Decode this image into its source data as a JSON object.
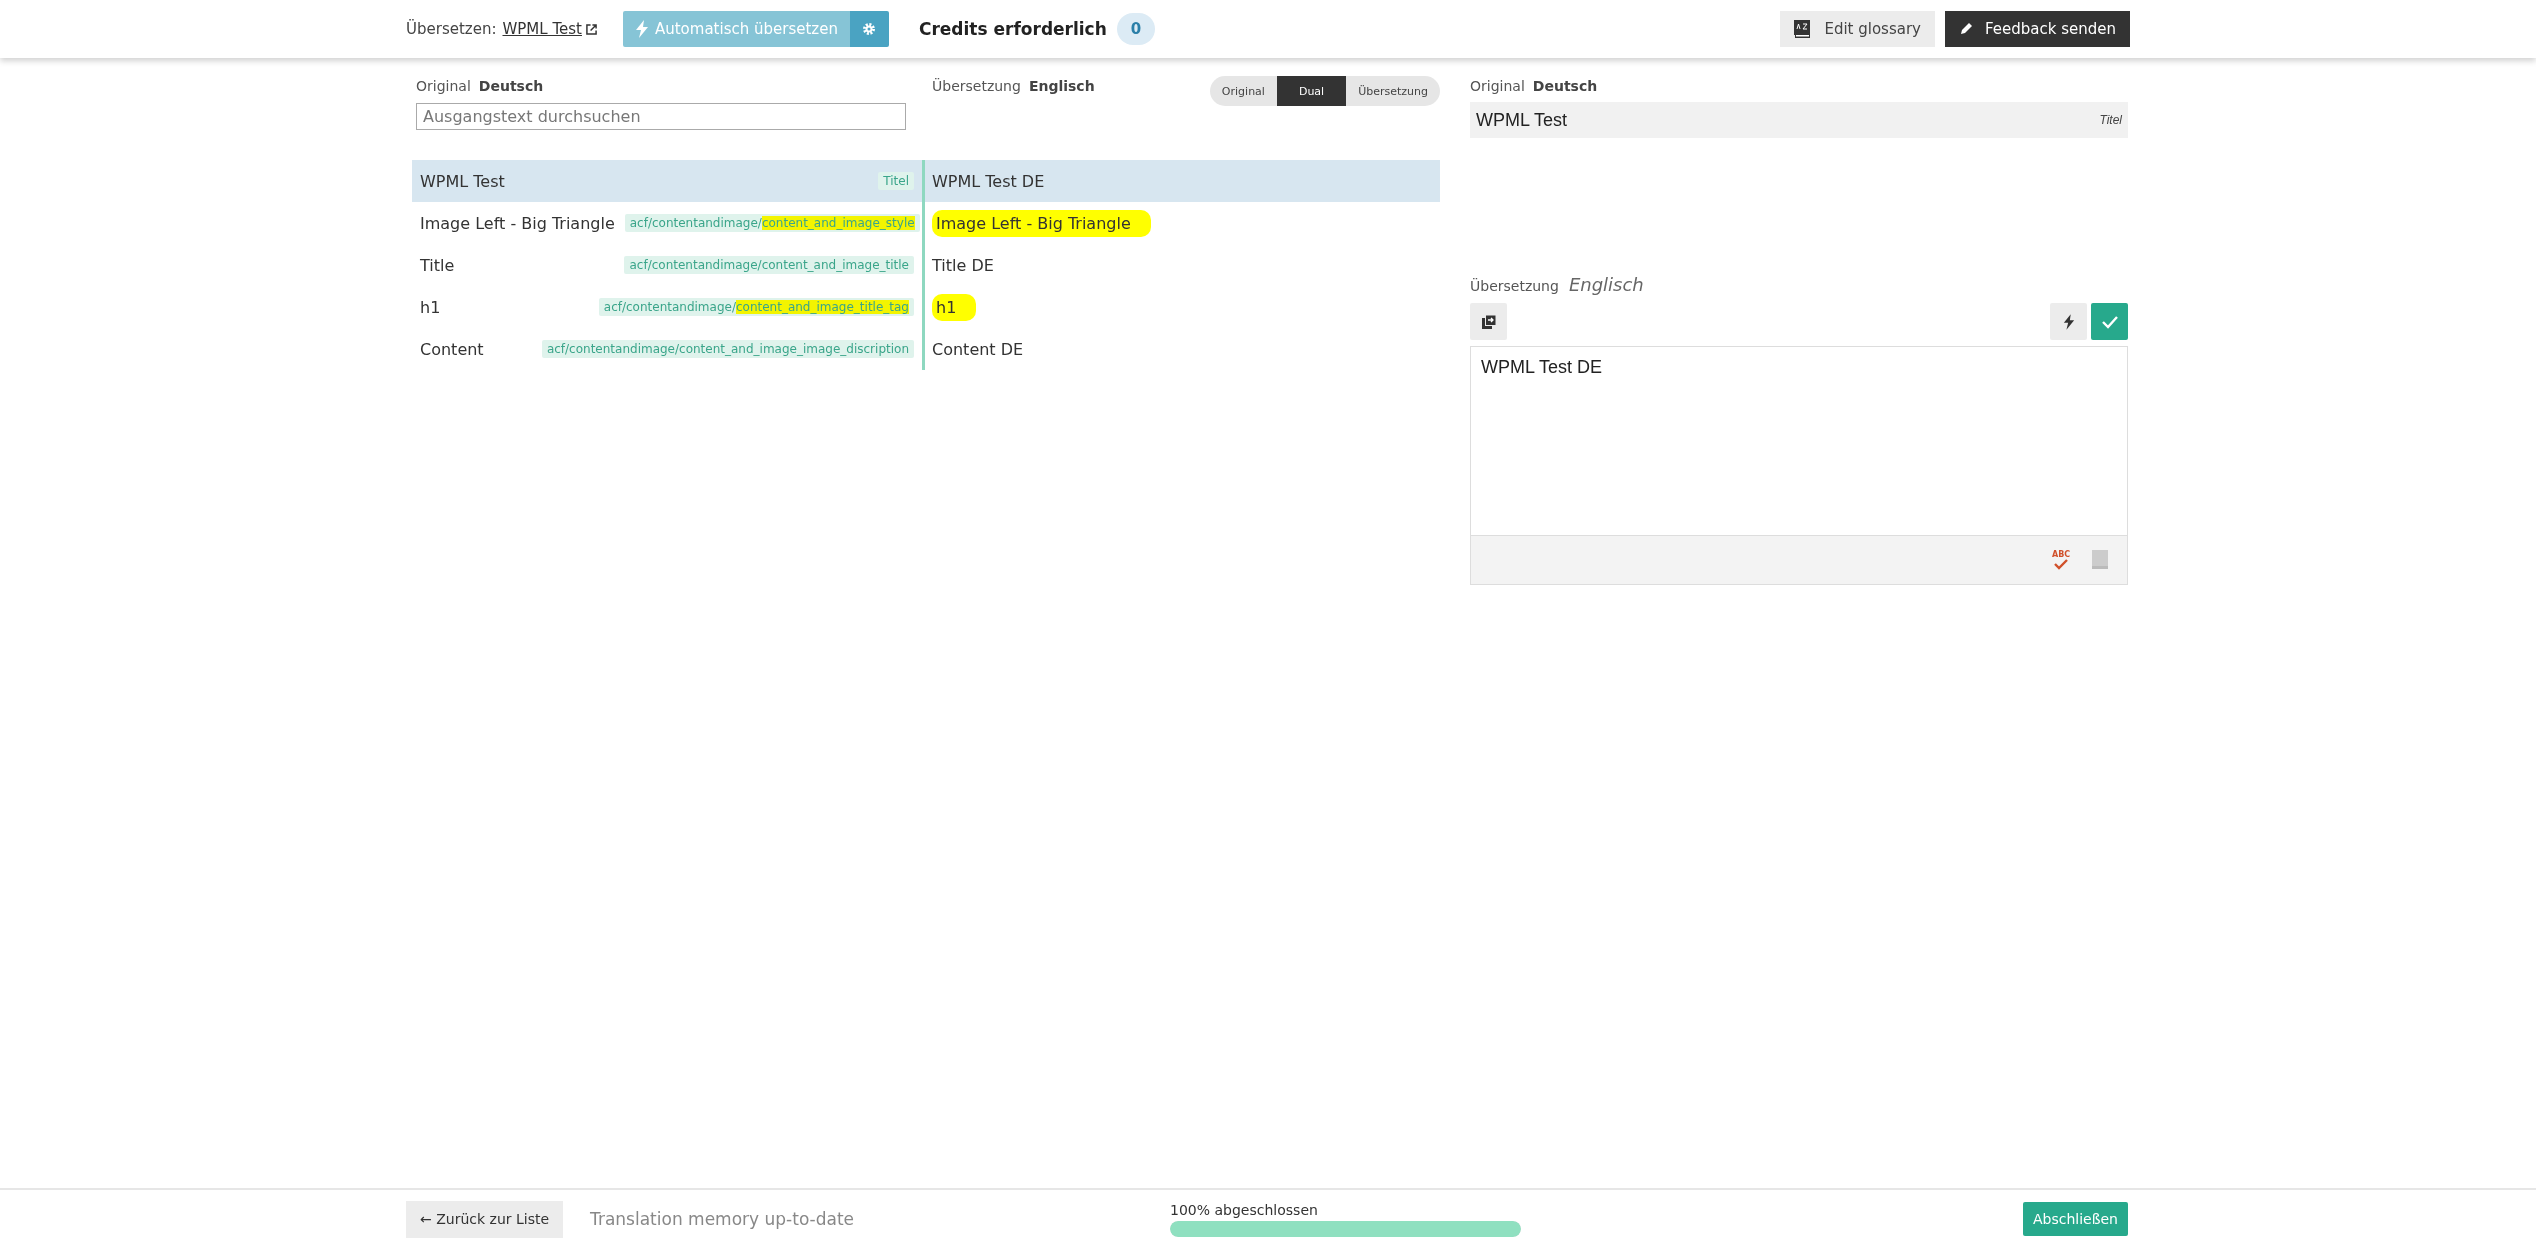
{
  "top_bar": {
    "translate_label": "Übersetzen:",
    "document_link": "WPML Test",
    "auto_translate_button": "Automatisch übersetzen",
    "credits_label": "Credits erforderlich",
    "credits_count": "0",
    "glossary_button": "Edit glossary",
    "feedback_button": "Feedback senden"
  },
  "source_header": {
    "label": "Original",
    "language": "Deutsch"
  },
  "target_header": {
    "label": "Übersetzung",
    "language": "Englisch"
  },
  "view_modes": [
    {
      "label": "Original",
      "selected": false
    },
    {
      "label": "Dual",
      "selected": true
    },
    {
      "label": "Übersetzung",
      "selected": false
    }
  ],
  "search": {
    "placeholder": "Ausgangstext durchsuchen"
  },
  "rows": [
    {
      "source": "WPML Test",
      "selected": true,
      "path_parts": [
        {
          "text": "Titel",
          "highlighted": false
        }
      ],
      "translation": {
        "text": "WPML Test DE",
        "highlighted": false
      }
    },
    {
      "source": "Image Left - Big Triangle",
      "selected": false,
      "path_parts": [
        {
          "text": "acf/contentandimage/",
          "highlighted": false
        },
        {
          "text": "content_and_image_style",
          "highlighted": true
        }
      ],
      "translation": {
        "text": "Image Left - Big Triangle",
        "highlighted": true
      }
    },
    {
      "source": "Title",
      "selected": false,
      "path_parts": [
        {
          "text": "acf/contentandimage/content_and_image_title",
          "highlighted": false
        }
      ],
      "translation": {
        "text": "Title DE",
        "highlighted": false
      }
    },
    {
      "source": "h1",
      "selected": false,
      "path_parts": [
        {
          "text": "acf/contentandimage/",
          "highlighted": false
        },
        {
          "text": "content_and_image_title_tag",
          "highlighted": true
        }
      ],
      "translation": {
        "text": "h1",
        "highlighted": true
      }
    },
    {
      "source": "Content",
      "selected": false,
      "path_parts": [
        {
          "text": "acf/contentandimage/content_and_image_image_discription",
          "highlighted": false
        }
      ],
      "translation": {
        "text": "Content DE",
        "highlighted": false
      }
    }
  ],
  "editor": {
    "original_label": "Original",
    "original_language": "Deutsch",
    "original_text": "WPML Test",
    "original_type": "Titel",
    "translation_label": "Übersetzung",
    "translation_language": "Englisch",
    "translation_value": "WPML Test DE",
    "spellcheck_label": "ABC"
  },
  "footer": {
    "back_button": "← Zurück zur Liste",
    "memory_status": "Translation memory up-to-date",
    "progress_label": "100% abgeschlossen",
    "progress": {
      "level": 1.0
    },
    "finish_button": "Abschließen"
  }
}
